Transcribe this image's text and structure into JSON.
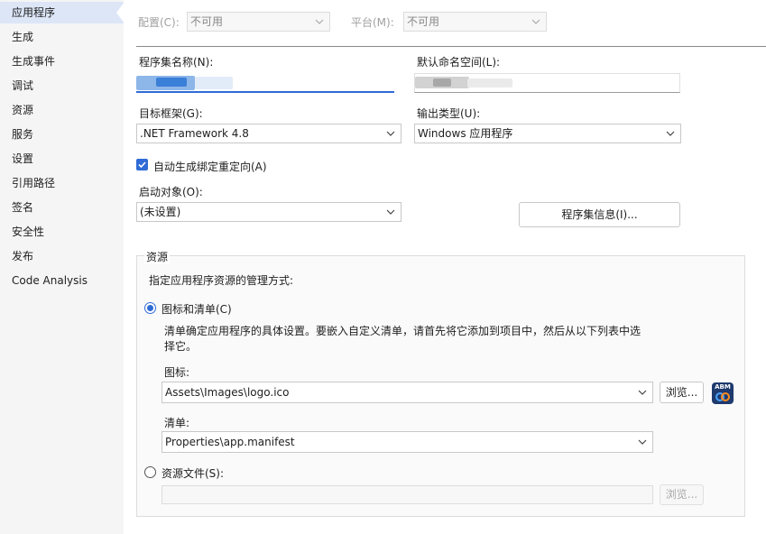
{
  "sidebar": {
    "items": [
      {
        "label": "应用程序",
        "active": true
      },
      {
        "label": "生成"
      },
      {
        "label": "生成事件"
      },
      {
        "label": "调试"
      },
      {
        "label": "资源"
      },
      {
        "label": "服务"
      },
      {
        "label": "设置"
      },
      {
        "label": "引用路径"
      },
      {
        "label": "签名"
      },
      {
        "label": "安全性"
      },
      {
        "label": "发布"
      },
      {
        "label": "Code Analysis"
      }
    ]
  },
  "toolbar": {
    "config_label": "配置(C):",
    "config_value": "不可用",
    "platform_label": "平台(M):",
    "platform_value": "不可用"
  },
  "form": {
    "assembly_name_label": "程序集名称(N):",
    "default_namespace_label": "默认命名空间(L):",
    "target_framework_label": "目标框架(G):",
    "target_framework_value": ".NET Framework 4.8",
    "output_type_label": "输出类型(U):",
    "output_type_value": "Windows 应用程序",
    "auto_binding_label": "自动生成绑定重定向(A)",
    "auto_binding_checked": true,
    "startup_object_label": "启动对象(O):",
    "startup_object_value": "(未设置)",
    "assembly_info_button": "程序集信息(I)..."
  },
  "resources": {
    "group_title": "资源",
    "description": "指定应用程序资源的管理方式:",
    "icon_manifest_label": "图标和清单(C)",
    "icon_manifest_desc_line1": "清单确定应用程序的具体设置。要嵌入自定义清单，请首先将它添加到项目中，然后从以下列表中选",
    "icon_manifest_desc_line2": "择它。",
    "icon_label": "图标:",
    "icon_value": "Assets\\Images\\logo.ico",
    "browse_button": "浏览...",
    "icon_preview_text": "ABM",
    "manifest_label": "清单:",
    "manifest_value": "Properties\\app.manifest",
    "resource_file_label": "资源文件(S):",
    "resource_file_value": "",
    "browse_disabled_button": "浏览..."
  },
  "colors": {
    "accent": "#2f6bd6",
    "sidebar_bg": "#f5f5f5",
    "active_bg": "#dce6f7"
  }
}
